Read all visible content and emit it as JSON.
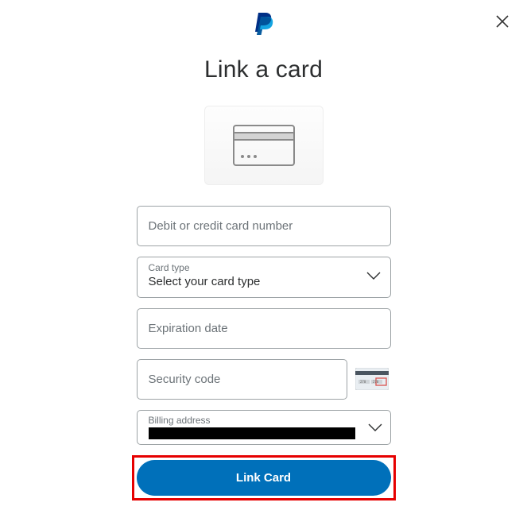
{
  "title": "Link a card",
  "fields": {
    "card_number_placeholder": "Debit or credit card number",
    "card_type_label": "Card type",
    "card_type_value": "Select your card type",
    "expiration_placeholder": "Expiration date",
    "security_placeholder": "Security code",
    "billing_label": "Billing address"
  },
  "submit_label": "Link Card"
}
